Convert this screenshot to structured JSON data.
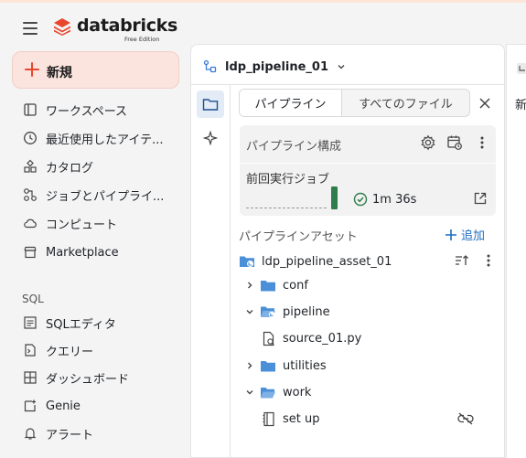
{
  "brand": {
    "name": "databricks",
    "edition": "Free Edition",
    "color": "#e8472d"
  },
  "new_button": {
    "label": "新規"
  },
  "nav": {
    "items": [
      {
        "label": "ワークスペース",
        "icon": "workspace-icon"
      },
      {
        "label": "最近使用したアイテ...",
        "icon": "clock-icon"
      },
      {
        "label": "カタログ",
        "icon": "catalog-icon"
      },
      {
        "label": "ジョブとパイプライ...",
        "icon": "jobs-pipelines-icon"
      },
      {
        "label": "コンピュート",
        "icon": "cloud-icon"
      },
      {
        "label": "Marketplace",
        "icon": "marketplace-icon"
      }
    ],
    "sql_section": "SQL",
    "sql_items": [
      {
        "label": "SQLエディタ",
        "icon": "sql-editor-icon"
      },
      {
        "label": "クエリー",
        "icon": "query-icon"
      },
      {
        "label": "ダッシュボード",
        "icon": "dashboard-icon"
      },
      {
        "label": "Genie",
        "icon": "genie-icon"
      },
      {
        "label": "アラート",
        "icon": "bell-icon"
      }
    ]
  },
  "pipeline": {
    "name": "ldp_pipeline_01"
  },
  "tabs": [
    {
      "label": "パイプライン",
      "active": true
    },
    {
      "label": "すべてのファイル",
      "active": false
    }
  ],
  "config": {
    "title": "パイプライン構成",
    "last_run_label": "前回実行ジョブ",
    "run_duration": "1m 36s",
    "run_status_color": "#2f7d4a"
  },
  "assets": {
    "header": "パイプラインアセット",
    "add_label": "追加",
    "root": "ldp_pipeline_asset_01",
    "tree": [
      {
        "label": "conf",
        "type": "folder",
        "expanded": false
      },
      {
        "label": "pipeline",
        "type": "folder",
        "expanded": true
      },
      {
        "label": "source_01.py",
        "type": "file"
      },
      {
        "label": "utilities",
        "type": "folder",
        "expanded": false
      },
      {
        "label": "work",
        "type": "folder",
        "expanded": true
      },
      {
        "label": "set up",
        "type": "notebook"
      }
    ]
  },
  "right_panel": {
    "text": "新"
  },
  "colors": {
    "accent": "#1f6dc0",
    "folder": "#4a8fd8",
    "new_bg": "#fbe3de"
  }
}
